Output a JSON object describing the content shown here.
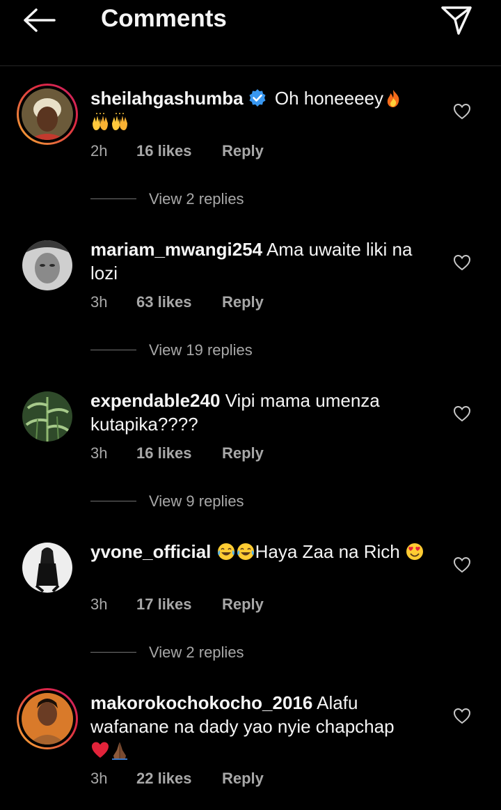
{
  "header": {
    "title": "Comments",
    "back_icon": "arrow-left-icon",
    "send_icon": "paper-plane-icon"
  },
  "colors": {
    "background": "#000000",
    "text_primary": "#f5f5f5",
    "text_secondary": "#a8a8a8",
    "verified_blue": "#3897f0",
    "story_ring": [
      "#f9b233",
      "#dc2743",
      "#cc2366"
    ]
  },
  "comments": [
    {
      "username": "sheilahgashumba",
      "verified": true,
      "has_story": true,
      "text": "Oh honeeeey",
      "emojis_inline": [
        "fire"
      ],
      "emojis_line2": [
        "raising-hands",
        "raising-hands"
      ],
      "time": "2h",
      "likes": "16 likes",
      "reply_label": "Reply",
      "view_replies": "View 2 replies"
    },
    {
      "username": "mariam_mwangi254",
      "verified": false,
      "has_story": false,
      "text": "Ama uwaite liki na lozi",
      "time": "3h",
      "likes": "63 likes",
      "reply_label": "Reply",
      "view_replies": "View 19 replies"
    },
    {
      "username": "expendable240",
      "verified": false,
      "has_story": false,
      "text": "Vipi mama umenza kutapika????",
      "time": "3h",
      "likes": "16 likes",
      "reply_label": "Reply",
      "view_replies": "View 9 replies"
    },
    {
      "username": "yvone_official",
      "verified": false,
      "has_story": false,
      "text": "Haya Zaa na Rich",
      "emojis_before": [
        "tears-of-joy",
        "tears-of-joy"
      ],
      "emojis_after": [
        "heart-eyes"
      ],
      "time": "3h",
      "likes": "17 likes",
      "reply_label": "Reply",
      "view_replies": "View 2 replies"
    },
    {
      "username": "makorokochokocho_2016",
      "verified": false,
      "has_story": true,
      "text": "Alafu wafanane na dady yao nyie chapchap",
      "emojis_after": [
        "red-heart",
        "folded-hands"
      ],
      "time": "3h",
      "likes": "22 likes",
      "reply_label": "Reply"
    }
  ]
}
